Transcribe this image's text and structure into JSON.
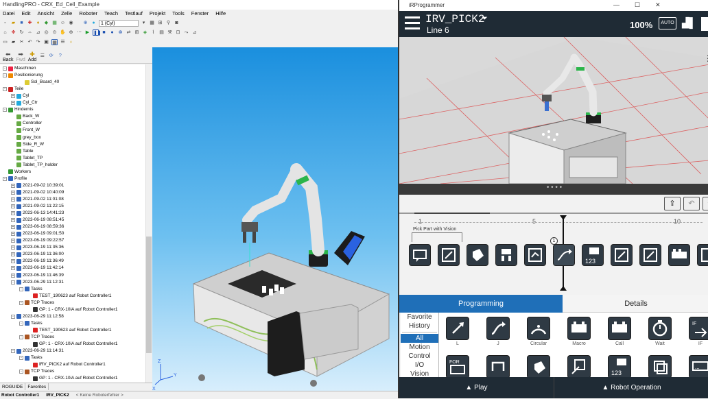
{
  "app": {
    "title": "HandlingPRO - CRX_Ed_Cell_Example",
    "menu": [
      "Datei",
      "Edit",
      "Ansicht",
      "Zelle",
      "Roboter",
      "Teach",
      "Testlauf",
      "Projekt",
      "Tools",
      "Fenster",
      "Hilfe"
    ],
    "toolbar_select": "1 (Cyl)"
  },
  "nav": {
    "back": "Back",
    "fwd": "Fwd",
    "add": "Add"
  },
  "tree": [
    {
      "label": "Maschinen",
      "indent": 1,
      "exp": "-",
      "icon": "#e24"
    },
    {
      "label": "Positionierung",
      "indent": 1,
      "exp": "-",
      "icon": "#e80"
    },
    {
      "label": "Sol_Board_40",
      "indent": 3,
      "exp": "",
      "icon": "#dc3"
    },
    {
      "label": "Teile",
      "indent": 1,
      "exp": "-",
      "icon": "#c22"
    },
    {
      "label": "Cyl",
      "indent": 2,
      "exp": "+",
      "icon": "#2ad"
    },
    {
      "label": "Cyl_Ctr",
      "indent": 2,
      "exp": "+",
      "icon": "#2ad"
    },
    {
      "label": "Hindernis",
      "indent": 1,
      "exp": "-",
      "icon": "#393"
    },
    {
      "label": "Back_W",
      "indent": 2,
      "exp": "",
      "icon": "#6a4"
    },
    {
      "label": "Controller",
      "indent": 2,
      "exp": "",
      "icon": "#6a4"
    },
    {
      "label": "Front_W",
      "indent": 2,
      "exp": "",
      "icon": "#6a4"
    },
    {
      "label": "grey_box",
      "indent": 2,
      "exp": "",
      "icon": "#6a4"
    },
    {
      "label": "Side_R_W",
      "indent": 2,
      "exp": "",
      "icon": "#6a4"
    },
    {
      "label": "Table",
      "indent": 2,
      "exp": "",
      "icon": "#6a4"
    },
    {
      "label": "Tablet_TP",
      "indent": 2,
      "exp": "",
      "icon": "#6a4"
    },
    {
      "label": "Tablet_TP_holder",
      "indent": 2,
      "exp": "",
      "icon": "#6a4"
    },
    {
      "label": "Workers",
      "indent": 1,
      "exp": "",
      "icon": "#393"
    },
    {
      "label": "Profile",
      "indent": 1,
      "exp": "-",
      "icon": "#36b"
    },
    {
      "label": "2021-09-02 10:39:01",
      "indent": 2,
      "exp": "+",
      "icon": "#36b"
    },
    {
      "label": "2021-09-02 10:40:09",
      "indent": 2,
      "exp": "+",
      "icon": "#36b"
    },
    {
      "label": "2021-09-02 11:01:08",
      "indent": 2,
      "exp": "+",
      "icon": "#36b"
    },
    {
      "label": "2021-09-02 11:22:15",
      "indent": 2,
      "exp": "+",
      "icon": "#36b"
    },
    {
      "label": "2023-06-13 14:41:23",
      "indent": 2,
      "exp": "+",
      "icon": "#36b"
    },
    {
      "label": "2023-06-19 08:51:45",
      "indent": 2,
      "exp": "+",
      "icon": "#36b"
    },
    {
      "label": "2023-06-19 08:59:36",
      "indent": 2,
      "exp": "+",
      "icon": "#36b"
    },
    {
      "label": "2023-06-19 09:01:50",
      "indent": 2,
      "exp": "+",
      "icon": "#36b"
    },
    {
      "label": "2023-06-19 09:22:57",
      "indent": 2,
      "exp": "+",
      "icon": "#36b"
    },
    {
      "label": "2023-06-19 11:35:36",
      "indent": 2,
      "exp": "+",
      "icon": "#36b"
    },
    {
      "label": "2023-06-19 11:36:00",
      "indent": 2,
      "exp": "+",
      "icon": "#36b"
    },
    {
      "label": "2023-06-19 11:36:49",
      "indent": 2,
      "exp": "+",
      "icon": "#36b"
    },
    {
      "label": "2023-06-19 11:42:14",
      "indent": 2,
      "exp": "+",
      "icon": "#36b"
    },
    {
      "label": "2023-06-19 11:46:39",
      "indent": 2,
      "exp": "+",
      "icon": "#36b"
    },
    {
      "label": "2023-06-29 11:12:31",
      "indent": 2,
      "exp": "-",
      "icon": "#36b"
    },
    {
      "label": "Tasks",
      "indent": 3,
      "exp": "-",
      "icon": "#36b"
    },
    {
      "label": "TEST_190623 auf Robot Controller1",
      "indent": 4,
      "exp": "",
      "icon": "#d22"
    },
    {
      "label": "TCP Traces",
      "indent": 3,
      "exp": "-",
      "icon": "#a52"
    },
    {
      "label": "GP: 1 - CRX-10iA auf Robot Controller1",
      "indent": 4,
      "exp": "",
      "icon": "#333"
    },
    {
      "label": "2023-06-29 11:12:58",
      "indent": 2,
      "exp": "-",
      "icon": "#36b"
    },
    {
      "label": "Tasks",
      "indent": 3,
      "exp": "-",
      "icon": "#36b"
    },
    {
      "label": "TEST_190623 auf Robot Controller1",
      "indent": 4,
      "exp": "",
      "icon": "#d22"
    },
    {
      "label": "TCP Traces",
      "indent": 3,
      "exp": "-",
      "icon": "#a52"
    },
    {
      "label": "GP: 1 - CRX-10iA auf Robot Controller1",
      "indent": 4,
      "exp": "",
      "icon": "#333"
    },
    {
      "label": "2023-06-29 11:14:31",
      "indent": 2,
      "exp": "-",
      "icon": "#36b"
    },
    {
      "label": "Tasks",
      "indent": 3,
      "exp": "-",
      "icon": "#36b"
    },
    {
      "label": "IRV_PICK2 auf Robot Controller1",
      "indent": 4,
      "exp": "",
      "icon": "#d22"
    },
    {
      "label": "TCP Traces",
      "indent": 3,
      "exp": "-",
      "icon": "#a52"
    },
    {
      "label": "GP: 1 - CRX-10iA auf Robot Controller1",
      "indent": 4,
      "exp": "",
      "icon": "#333"
    }
  ],
  "tabs": [
    "ROGUIDE",
    "Favorites"
  ],
  "status": [
    "Robot Controller1",
    "IRV_PICK2",
    "< Keine Roboterfehler >"
  ],
  "irp": {
    "title": "iRProgrammer",
    "program": "IRV_PICK2",
    "line": "Line 6",
    "percent": "100%",
    "auto": "AUTO",
    "timeline_nums": [
      "1",
      "5",
      "10"
    ],
    "block_label": "Pick Part with Vision",
    "marker": "1",
    "tab_programming": "Programming",
    "tab_details": "Details",
    "categories": [
      "Favorite",
      "History",
      "All",
      "Motion",
      "Control",
      "I/O",
      "Vision"
    ],
    "palette_row1": [
      "L",
      "J",
      "Circular",
      "Macro",
      "Call",
      "Wait",
      "IF"
    ],
    "palette_row2_badges": [
      "FOR",
      "",
      "",
      "",
      "123",
      "",
      ""
    ],
    "play": "▲ Play",
    "robot_operation": "▲ Robot Operation"
  }
}
